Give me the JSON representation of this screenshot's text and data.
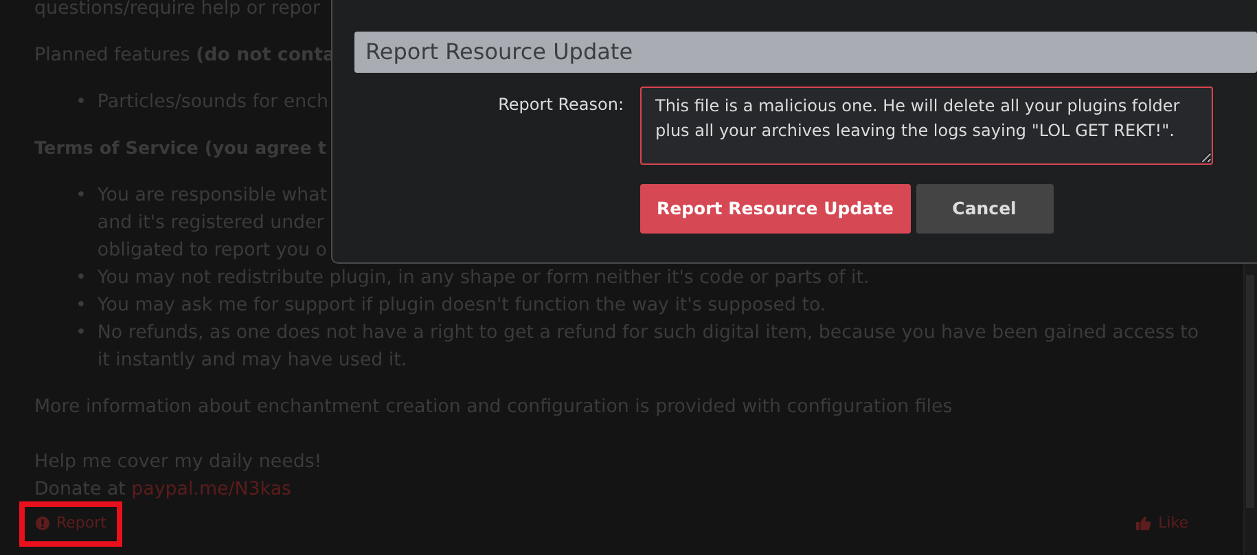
{
  "article": {
    "intro_fragment": "questions/require help or repor",
    "planned_heading": "Planned features **(do not conta**",
    "planned_items": [
      {
        "marker": "•",
        "lines": [
          "Particles/sounds for ench"
        ]
      }
    ],
    "terms_heading": "Terms of Service (you agree t",
    "terms_items": [
      {
        "marker": "•",
        "lines": [
          "You are responsible what",
          "and it's registered under",
          "obligated to report you o"
        ]
      },
      {
        "marker": "•",
        "lines": [
          "You may not redistribute plugin, in any shape or form neither it's code or parts of it."
        ]
      },
      {
        "marker": "•",
        "lines": [
          "You may ask me for support if plugin doesn't function the way it's supposed to."
        ]
      },
      {
        "marker": "•",
        "lines": [
          "No refunds, as one does not have a right to get a refund for such digital item, because you have been gained access to",
          "it instantly and may have used it."
        ]
      }
    ],
    "more_info": "More information about enchantment creation and configuration is provided with configuration files",
    "help": "Help me cover my daily needs!",
    "donate_text": "Donate at",
    "donate_link": "paypal.me/N3kas"
  },
  "post_actions": {
    "report": {
      "label": "Report",
      "highlighted": true
    },
    "like": {
      "label": "Like"
    }
  },
  "dialog": {
    "title": "Report Resource Update",
    "field_label": "Report Reason:",
    "reason": "This file is a malicious one. He will delete all your plugins folder plus all your archives leaving the logs saying \"LOL GET REKT!\".",
    "invalid": true,
    "buttons": [
      {
        "label": "Report Resource Update",
        "kind": "primary"
      },
      {
        "label": "Cancel",
        "kind": "secondary"
      }
    ]
  }
}
